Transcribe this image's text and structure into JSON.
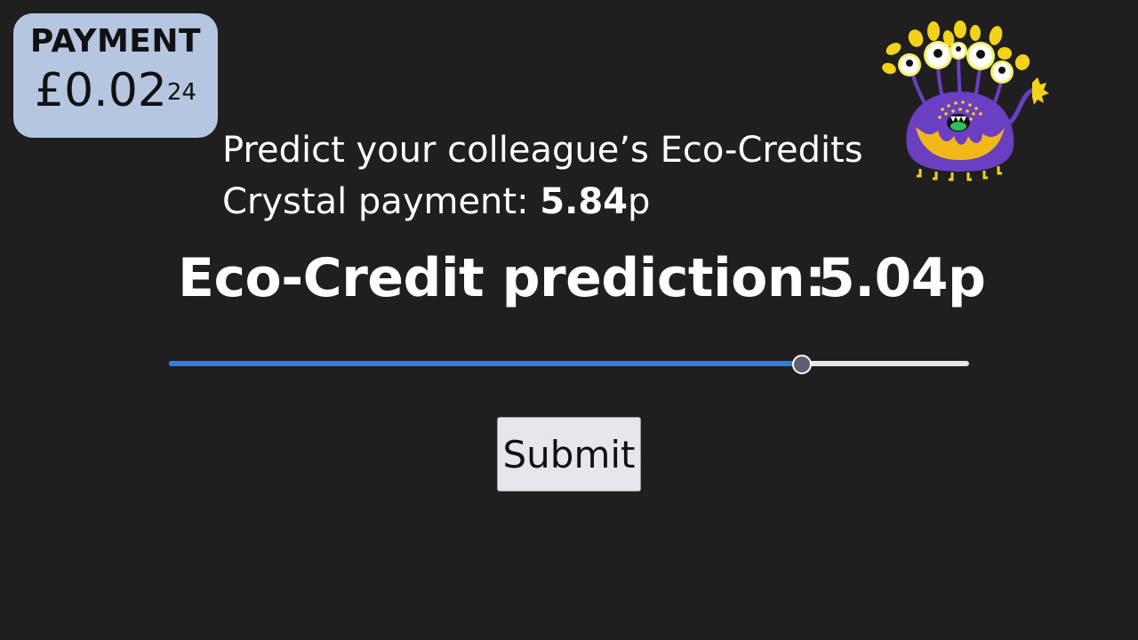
{
  "payment": {
    "title": "PAYMENT",
    "amount": "£0.02",
    "amount_superscript": "24"
  },
  "instruction": {
    "line1": "Predict your colleague’s Eco-Credits",
    "line2_prefix": "Crystal payment: ",
    "line2_value": "5.84",
    "line2_unit": "p"
  },
  "prediction": {
    "label": "Eco-Credit prediction:",
    "value": "5.04p"
  },
  "slider": {
    "fraction": 0.79,
    "fill_color": "#2f7fe0",
    "track_color": "#e6e6ea"
  },
  "submit": {
    "label": "Submit"
  },
  "monster": {
    "icon": "purple-monster-icon",
    "body_color": "#6a3fc1",
    "accent_color": "#f2d21b"
  },
  "colors": {
    "background": "#1f1f1f",
    "badge": "#b5c6e0"
  }
}
